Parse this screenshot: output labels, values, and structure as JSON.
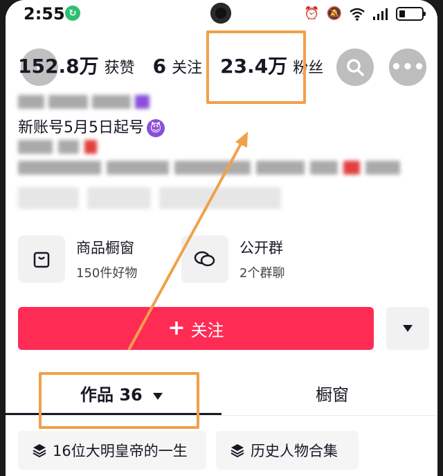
{
  "status_bar": {
    "time": "2:55",
    "icons": [
      "alarm-icon",
      "mute-icon",
      "wifi-icon",
      "signal-icon",
      "battery-icon"
    ]
  },
  "profile": {
    "stats": [
      {
        "value": "152.8万",
        "label": "获赞"
      },
      {
        "value": "6",
        "label": "关注"
      },
      {
        "value": "23.4万",
        "label": "粉丝"
      }
    ],
    "bio_line": "新账号5月5日起号"
  },
  "cards": [
    {
      "title": "商品橱窗",
      "subtitle": "150件好物",
      "icon": "shopping-bag-icon"
    },
    {
      "title": "公开群",
      "subtitle": "2个群聊",
      "icon": "chat-bubbles-icon"
    }
  ],
  "follow_button": {
    "label": "关注"
  },
  "tabs": [
    {
      "label": "作品 36",
      "active": true
    },
    {
      "label": "橱窗",
      "active": false
    }
  ],
  "collections": [
    {
      "label": "16位大明皇帝的一生"
    },
    {
      "label": "历史人物合集"
    }
  ],
  "colors": {
    "accent": "#fe2c55",
    "annotation": "#f0a04b"
  }
}
